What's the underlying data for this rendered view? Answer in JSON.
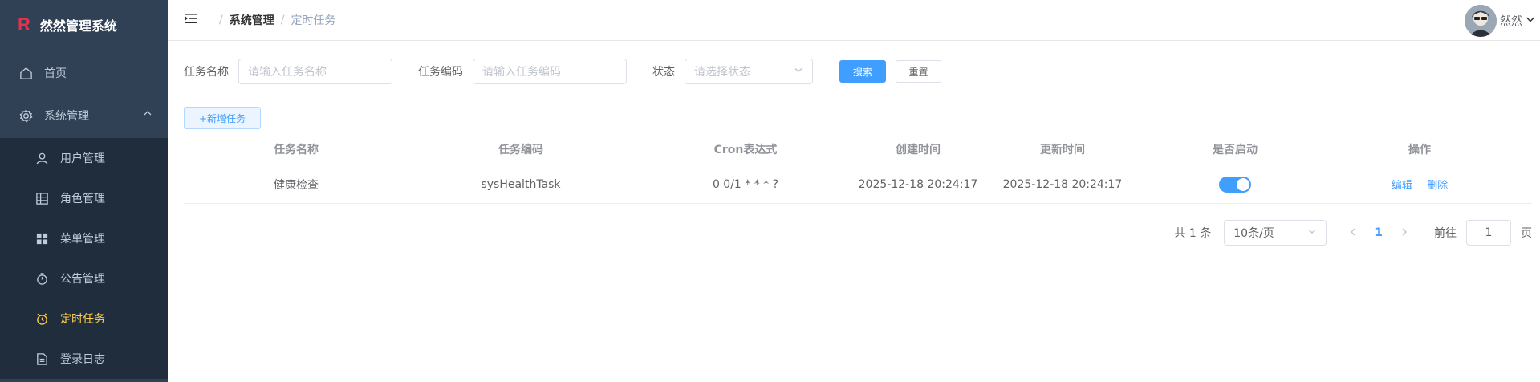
{
  "app": {
    "logo_mark": "R",
    "title": "然然管理系统"
  },
  "sidebar": {
    "items": [
      {
        "label": "首页",
        "icon": "home-icon"
      },
      {
        "label": "系统管理",
        "icon": "gear-icon",
        "expanded": true
      },
      {
        "label": "用户管理",
        "icon": "user-icon"
      },
      {
        "label": "角色管理",
        "icon": "table-icon"
      },
      {
        "label": "菜单管理",
        "icon": "grid-icon"
      },
      {
        "label": "公告管理",
        "icon": "stopwatch-icon"
      },
      {
        "label": "定时任务",
        "icon": "alarm-clock-icon",
        "active": true
      },
      {
        "label": "登录日志",
        "icon": "document-icon"
      }
    ],
    "colors": {
      "bg": "#304156",
      "active": "#ffd04b",
      "sub_bg": "#1f2d3d"
    }
  },
  "navbar": {
    "breadcrumb": [
      "系统管理",
      "定时任务"
    ],
    "separator": "/",
    "username": "然然"
  },
  "search": {
    "task_name_label": "任务名称",
    "task_name_placeholder": "请输入任务名称",
    "task_code_label": "任务编码",
    "task_code_placeholder": "请输入任务编码",
    "status_label": "状态",
    "status_placeholder": "请选择状态",
    "search_button": "搜索",
    "reset_button": "重置"
  },
  "toolbar": {
    "add_button": "+新增任务"
  },
  "table": {
    "headers": [
      "任务名称",
      "任务编码",
      "Cron表达式",
      "创建时间",
      "更新时间",
      "是否启动",
      "操作"
    ],
    "rows": [
      {
        "name": "健康检查",
        "code": "sysHealthTask",
        "cron": "0 0/1 * * * ?",
        "created": "2025-12-18 20:24:17",
        "updated": "2025-12-18 20:24:17",
        "enabled": true,
        "edit": "编辑",
        "delete": "删除"
      }
    ]
  },
  "pagination": {
    "total": "共 1 条",
    "page_size": "10条/页",
    "current_page": "1",
    "goto_label": "前往",
    "goto_value": "1",
    "page_suffix": "页"
  },
  "colors": {
    "primary": "#409eff"
  }
}
